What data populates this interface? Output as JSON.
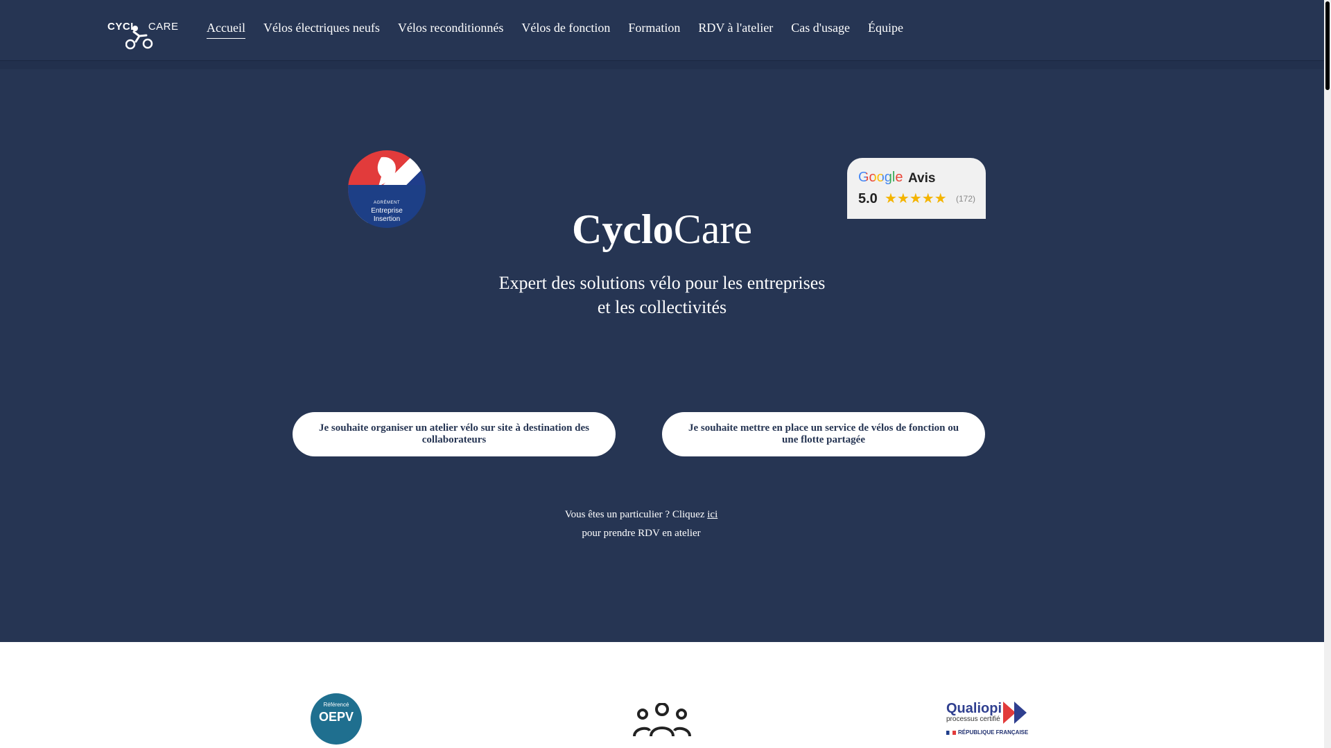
{
  "header": {
    "logo_left": "CYCL",
    "logo_right": "CARE",
    "nav": [
      {
        "label": "Accueil",
        "active": true
      },
      {
        "label": "Vélos électriques neufs"
      },
      {
        "label": "Vélos reconditionnés"
      },
      {
        "label": "Vélos de fonction"
      },
      {
        "label": "Formation"
      },
      {
        "label": "RDV à l'atelier"
      },
      {
        "label": "Cas d'usage"
      },
      {
        "label": "Équipe"
      }
    ]
  },
  "hero": {
    "agrement": {
      "small": "AGRÉMENT",
      "line1": "Entreprise",
      "line2": "Insertion"
    },
    "google": {
      "brand": "Google",
      "avis": "Avis",
      "rating": "5.0",
      "stars": "★★★★★",
      "count": "(172)"
    },
    "title_bold": "Cyclo",
    "title_regular": "Care",
    "tagline_line1": "Expert des solutions vélo pour les entreprises",
    "tagline_line2": "et les collectivités",
    "cta_left": "Je souhaite organiser un atelier vélo sur site à destination des collaborateurs",
    "cta_right": "Je souhaite mettre en place un service de vélos de fonction ou une flotte partagée",
    "particulier_pre": "Vous êtes un particulier ? Cliquez ",
    "particulier_link": "ici",
    "particulier_post": "pour prendre RDV en atelier"
  },
  "bottom": {
    "oepv_ref": "Référencé",
    "oepv_name": "OEPV",
    "qualiopi_name": "Qualiopi",
    "qualiopi_sub": "processus certifié",
    "qualiopi_rf": "RÉPUBLIQUE FRANÇAISE"
  },
  "colors": {
    "hero_bg": "#263553",
    "button_bg": "#ffffff",
    "star": "#f4b400"
  }
}
